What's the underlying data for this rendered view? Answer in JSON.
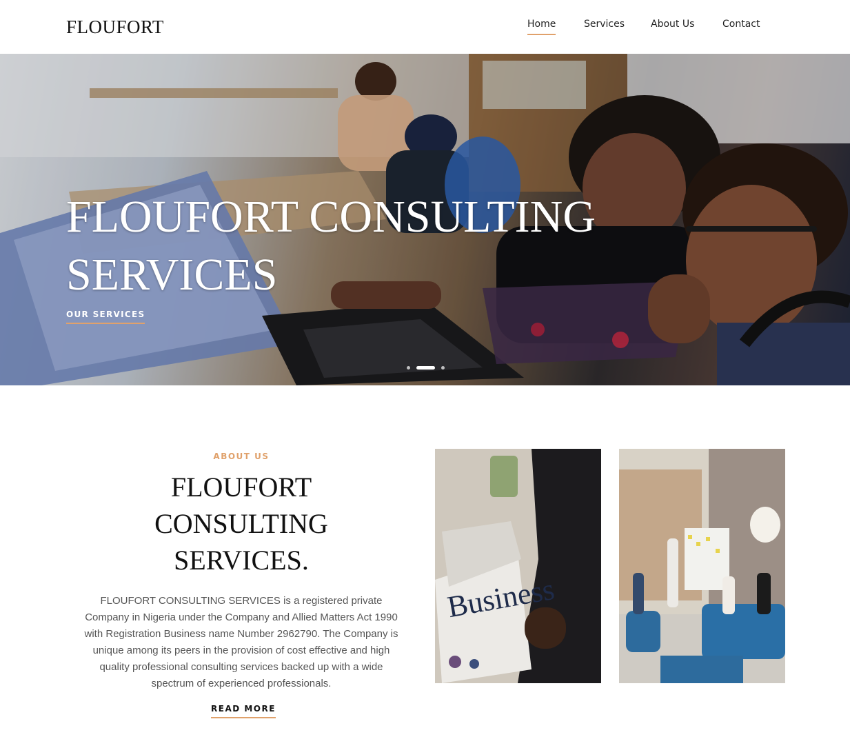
{
  "header": {
    "logo": "FLOUFORT",
    "nav": [
      {
        "label": "Home",
        "active": true
      },
      {
        "label": "Services",
        "active": false
      },
      {
        "label": "About Us",
        "active": false
      },
      {
        "label": "Contact",
        "active": false
      }
    ]
  },
  "hero": {
    "title_line1": "FLOUFORT CONSULTING",
    "title_line2": "SERVICES",
    "cta": "OUR SERVICES",
    "slides": 3,
    "active_slide": 2
  },
  "about": {
    "eyebrow": "ABOUT US",
    "title_line1": "FLOUFORT",
    "title_line2": "CONSULTING",
    "title_line3": "SERVICES.",
    "body": "FLOUFORT CONSULTING SERVICES is a registered private Company in Nigeria under the Company and Allied Matters Act 1990 with Registration Business name Number 2962790. The Company is unique among its peers in the provision of cost effective and high quality professional consulting services backed up with a wide spectrum of experienced professionals.",
    "read_more": "READ MORE",
    "photo1_text": "Business"
  },
  "colors": {
    "accent": "#e0a16b",
    "text_dark": "#111111",
    "text_muted": "#555555"
  }
}
